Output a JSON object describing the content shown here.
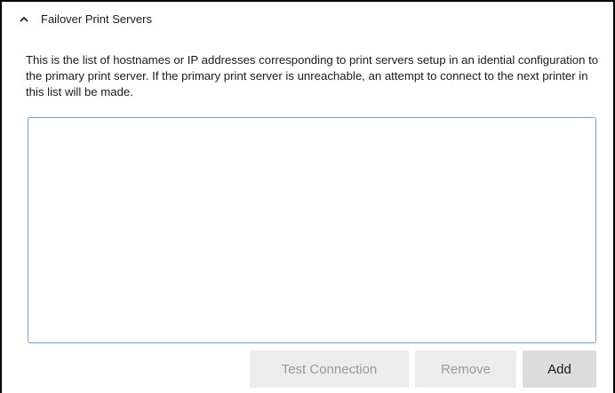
{
  "section": {
    "title": "Failover Print Servers",
    "expanded": true,
    "icon": "chevron-up-icon"
  },
  "description": "This is the list of hostnames or IP addresses corresponding to print servers setup in an idential configuration to the primary print server. If the primary print server is unreachable, an attempt to connect to the next printer in this list will be made.",
  "server_list": {
    "items": []
  },
  "buttons": {
    "test_connection": "Test Connection",
    "remove": "Remove",
    "add": "Add"
  },
  "colors": {
    "list_border": "#7a9cc9",
    "button_enabled_bg": "#dcdcdc",
    "button_disabled_bg": "#ececec",
    "button_disabled_text": "#9a9a9a"
  }
}
